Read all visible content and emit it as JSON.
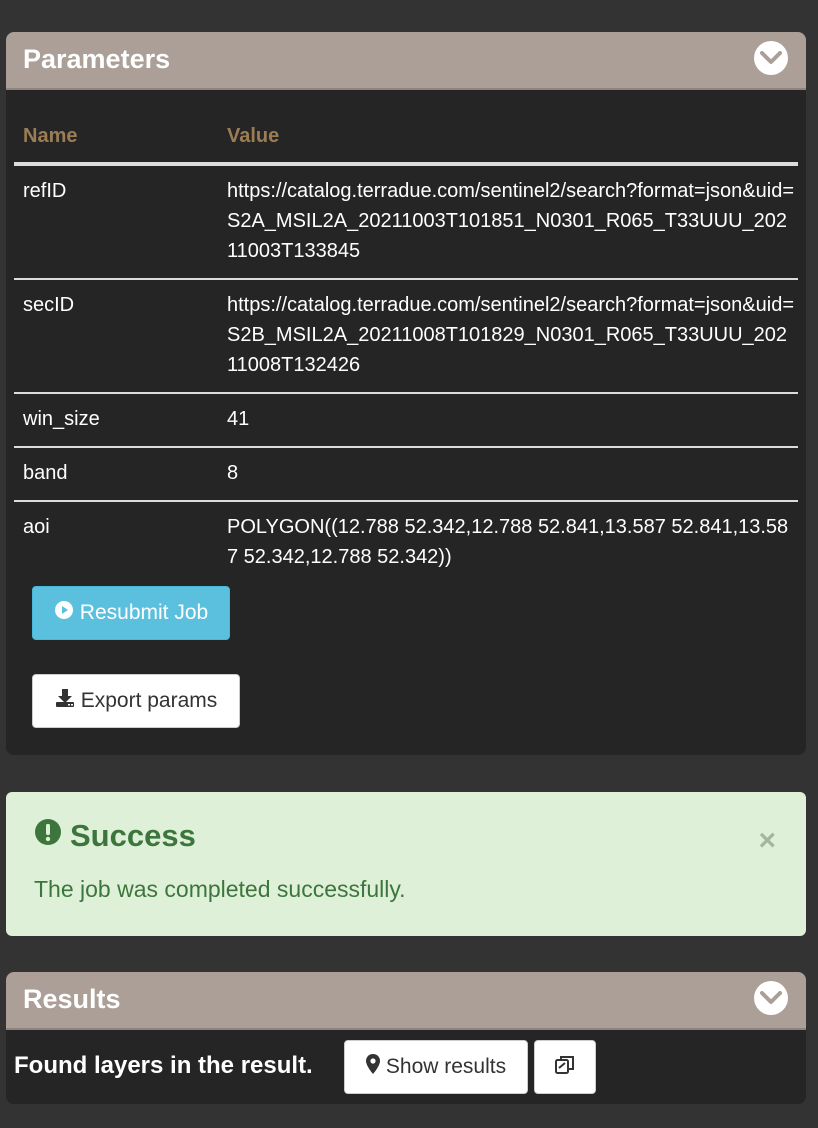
{
  "parameters": {
    "title": "Parameters",
    "columns": {
      "name": "Name",
      "value": "Value"
    },
    "rows": [
      {
        "name": "refID",
        "value": "https://catalog.terradue.com/sentinel2/search?format=json&uid=S2A_MSIL2A_20211003T101851_N0301_R065_T33UUU_20211003T133845"
      },
      {
        "name": "secID",
        "value": "https://catalog.terradue.com/sentinel2/search?format=json&uid=S2B_MSIL2A_20211008T101829_N0301_R065_T33UUU_20211008T132426"
      },
      {
        "name": "win_size",
        "value": "41"
      },
      {
        "name": "band",
        "value": "8"
      },
      {
        "name": "aoi",
        "value": "POLYGON((12.788 52.342,12.788 52.841,13.587 52.841,13.587 52.342,12.788 52.342))"
      }
    ],
    "resubmit_label": "Resubmit Job",
    "export_label": "Export params"
  },
  "alert": {
    "title": "Success",
    "message": "The job was completed successfully.",
    "close_symbol": "×"
  },
  "results": {
    "title": "Results",
    "text": "Found layers in the result.",
    "show_label": "Show results"
  },
  "icons": {
    "collapse": "chevron-down-circle-icon",
    "resubmit": "play-circle-icon",
    "export": "download-icon",
    "alert": "exclamation-circle-icon",
    "show": "map-marker-icon",
    "copy": "copy-icon"
  },
  "colors": {
    "header_bg": "#ab9f98",
    "panel_bg": "#252525",
    "page_bg": "#333333",
    "column_header": "#9a7d55",
    "resubmit_bg": "#5bc0de",
    "alert_bg": "#dff0d8",
    "alert_text": "#3c763d"
  }
}
